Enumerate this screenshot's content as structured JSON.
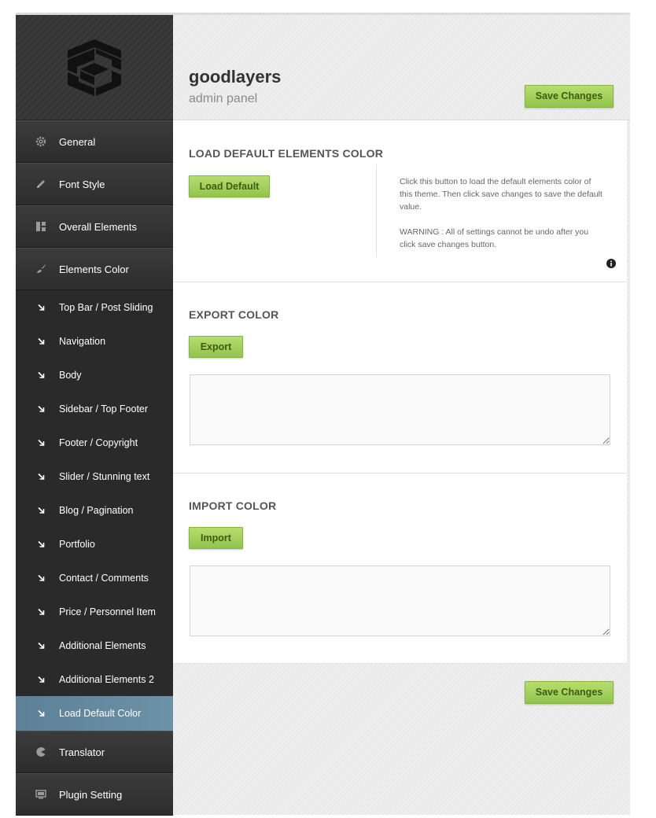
{
  "brand": {
    "title": "goodlayers",
    "subtitle": "admin panel"
  },
  "header": {
    "save_label": "Save Changes"
  },
  "footer": {
    "save_label": "Save Changes"
  },
  "sidebar": {
    "main_items_top": [
      {
        "label": "General",
        "icon": "gear-icon"
      },
      {
        "label": "Font Style",
        "icon": "pencil-icon"
      },
      {
        "label": "Overall Elements",
        "icon": "layout-icon"
      },
      {
        "label": "Elements Color",
        "icon": "paintbrush-icon"
      }
    ],
    "sub_items": [
      {
        "label": "Top Bar / Post Sliding"
      },
      {
        "label": "Navigation"
      },
      {
        "label": "Body"
      },
      {
        "label": "Sidebar / Top Footer"
      },
      {
        "label": "Footer / Copyright"
      },
      {
        "label": "Slider / Stunning text"
      },
      {
        "label": "Blog / Pagination"
      },
      {
        "label": "Portfolio"
      },
      {
        "label": "Contact / Comments"
      },
      {
        "label": "Price / Personnel Item"
      },
      {
        "label": "Additional Elements"
      },
      {
        "label": "Additional Elements 2"
      },
      {
        "label": "Load Default Color",
        "active": true
      }
    ],
    "main_items_bottom": [
      {
        "label": "Translator",
        "icon": "pacman-icon"
      },
      {
        "label": "Plugin Setting",
        "icon": "monitor-icon"
      }
    ]
  },
  "sections": {
    "load_default": {
      "title": "LOAD DEFAULT ELEMENTS COLOR",
      "button_label": "Load Default",
      "desc_1": "Click this button to load the default elements color of this theme. Then click save changes to save the default value.",
      "desc_2": "WARNING : All of settings cannot be undo after you click save changes button."
    },
    "export": {
      "title": "EXPORT COLOR",
      "button_label": "Export",
      "textarea_value": ""
    },
    "import": {
      "title": "IMPORT COLOR",
      "button_label": "Import",
      "textarea_value": ""
    }
  },
  "colors": {
    "sidebar_bg": "#2f2f2f",
    "active_item": "#6c92a8",
    "button_green": "#a6d35f",
    "button_text": "#3e5b12"
  }
}
